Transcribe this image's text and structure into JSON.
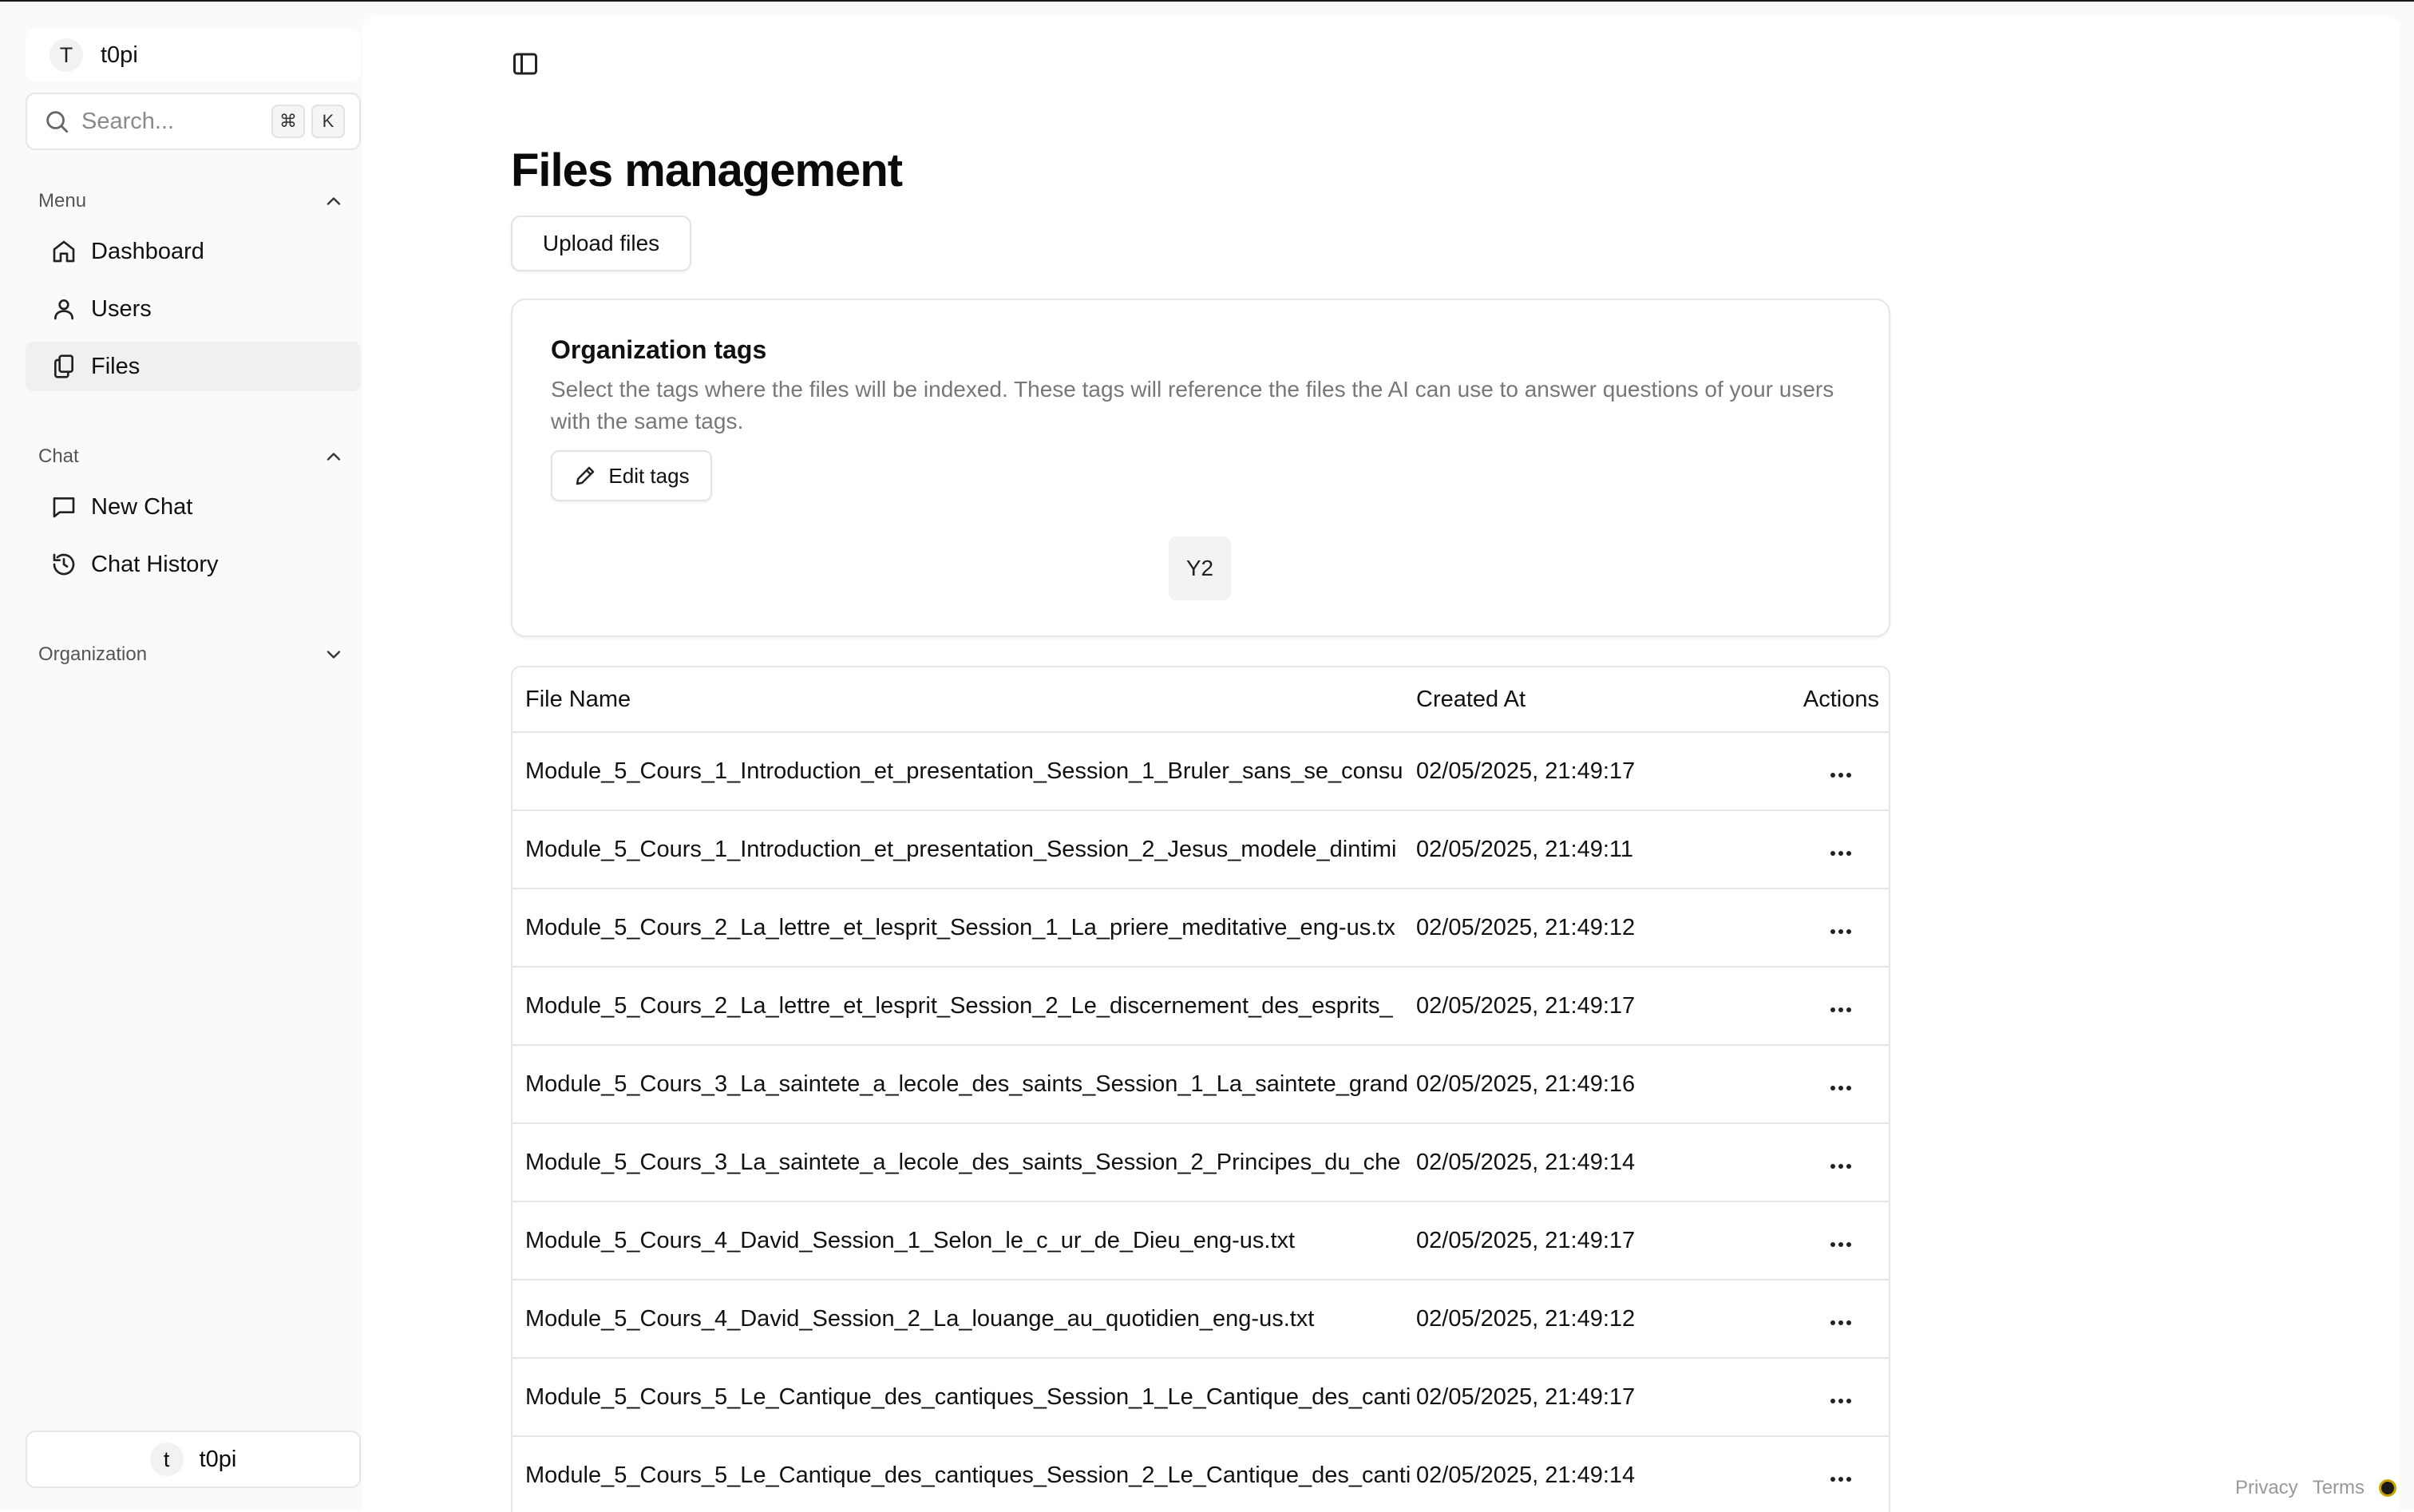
{
  "workspace": {
    "avatar_letter": "T",
    "name": "t0pi"
  },
  "search": {
    "placeholder": "Search...",
    "shortcut_cmd": "⌘",
    "shortcut_key": "K"
  },
  "sidebar": {
    "menu_label": "Menu",
    "menu_items": [
      {
        "label": "Dashboard",
        "icon": "home-icon"
      },
      {
        "label": "Users",
        "icon": "user-icon"
      },
      {
        "label": "Files",
        "icon": "files-icon",
        "active": true
      }
    ],
    "chat_label": "Chat",
    "chat_items": [
      {
        "label": "New Chat",
        "icon": "message-square-icon"
      },
      {
        "label": "Chat History",
        "icon": "history-icon"
      }
    ],
    "organization_label": "Organization"
  },
  "user": {
    "avatar_letter": "t",
    "name": "t0pi"
  },
  "main": {
    "title": "Files management",
    "upload_label": "Upload files",
    "tags": {
      "title": "Organization tags",
      "description": "Select the tags where the files will be indexed. These tags will reference the files the AI can use to answer questions of your users with the same tags.",
      "edit_label": "Edit tags",
      "chips": [
        "Y2"
      ]
    },
    "table": {
      "headers": {
        "name": "File Name",
        "created": "Created At",
        "actions": "Actions"
      },
      "rows": [
        {
          "name": "Module_5_Cours_1_Introduction_et_presentation_Session_1_Bruler_sans_se_consu",
          "created": "02/05/2025, 21:49:17"
        },
        {
          "name": "Module_5_Cours_1_Introduction_et_presentation_Session_2_Jesus_modele_dintimi",
          "created": "02/05/2025, 21:49:11"
        },
        {
          "name": "Module_5_Cours_2_La_lettre_et_lesprit_Session_1_La_priere_meditative_eng-us.tx",
          "created": "02/05/2025, 21:49:12"
        },
        {
          "name": "Module_5_Cours_2_La_lettre_et_lesprit_Session_2_Le_discernement_des_esprits_",
          "created": "02/05/2025, 21:49:17"
        },
        {
          "name": "Module_5_Cours_3_La_saintete_a_lecole_des_saints_Session_1_La_saintete_grand",
          "created": "02/05/2025, 21:49:16"
        },
        {
          "name": "Module_5_Cours_3_La_saintete_a_lecole_des_saints_Session_2_Principes_du_che",
          "created": "02/05/2025, 21:49:14"
        },
        {
          "name": "Module_5_Cours_4_David_Session_1_Selon_le_c_ur_de_Dieu_eng-us.txt",
          "created": "02/05/2025, 21:49:17"
        },
        {
          "name": "Module_5_Cours_4_David_Session_2_La_louange_au_quotidien_eng-us.txt",
          "created": "02/05/2025, 21:49:12"
        },
        {
          "name": "Module_5_Cours_5_Le_Cantique_des_cantiques_Session_1_Le_Cantique_des_canti",
          "created": "02/05/2025, 21:49:17"
        },
        {
          "name": "Module_5_Cours_5_Le_Cantique_des_cantiques_Session_2_Le_Cantique_des_canti",
          "created": "02/05/2025, 21:49:14"
        }
      ]
    }
  },
  "footer": {
    "privacy": "Privacy",
    "terms": "Terms"
  }
}
